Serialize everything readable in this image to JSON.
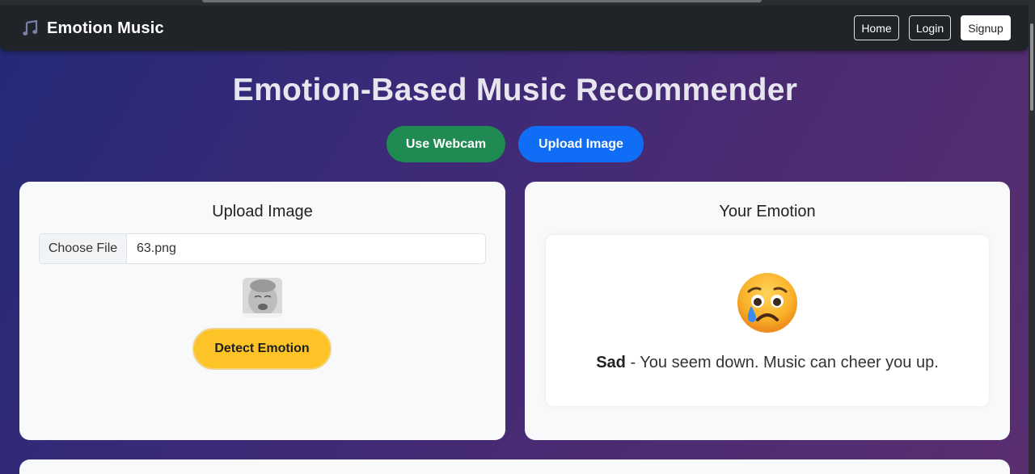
{
  "navbar": {
    "brand": "Emotion Music",
    "brand_icon": "music-notes-icon",
    "links": {
      "home": "Home",
      "login": "Login",
      "signup": "Signup"
    }
  },
  "page": {
    "title": "Emotion-Based Music Recommender",
    "modes": {
      "webcam": "Use Webcam",
      "upload": "Upload Image"
    }
  },
  "upload_card": {
    "heading": "Upload Image",
    "choose_label": "Choose File",
    "file_name": "63.png",
    "detect_label": "Detect Emotion"
  },
  "emotion_card": {
    "heading": "Your Emotion",
    "emoji_icon": "sad-face-tear-icon",
    "emotion": "Sad",
    "message": " - You seem down. Music can cheer you up."
  },
  "colors": {
    "webcam_btn": "#1f8a52",
    "upload_btn": "#0f6ef5",
    "detect_btn": "#fdc327",
    "navbar": "#202327"
  }
}
